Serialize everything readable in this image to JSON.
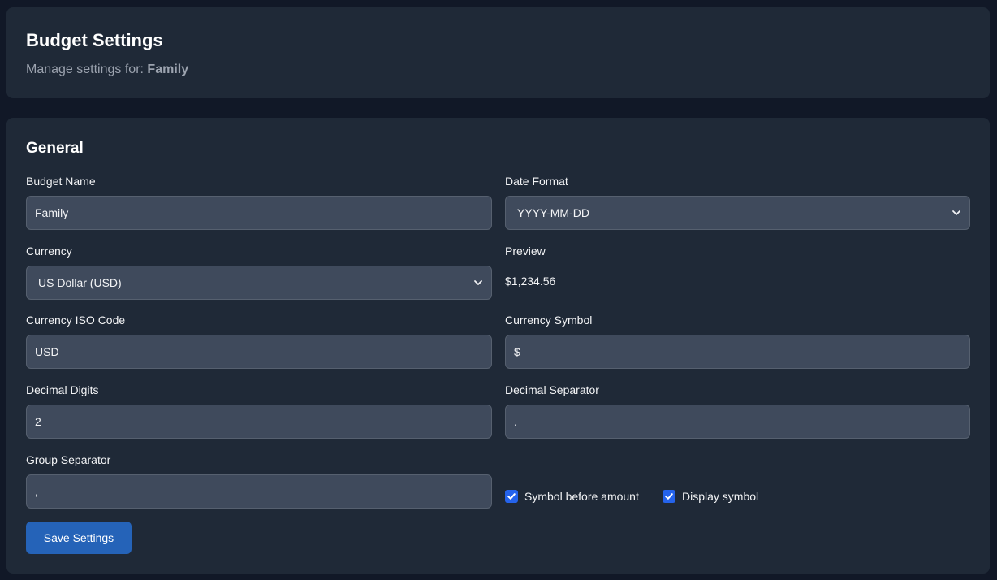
{
  "header": {
    "title": "Budget Settings",
    "subtitle_prefix": "Manage settings for:",
    "budget_name": "Family"
  },
  "general": {
    "section_title": "General",
    "budget_name": {
      "label": "Budget Name",
      "value": "Family"
    },
    "date_format": {
      "label": "Date Format",
      "value": "YYYY-MM-DD"
    },
    "currency": {
      "label": "Currency",
      "value": "US Dollar (USD)"
    },
    "preview": {
      "label": "Preview",
      "value": "$1,234.56"
    },
    "currency_iso": {
      "label": "Currency ISO Code",
      "value": "USD"
    },
    "currency_symbol": {
      "label": "Currency Symbol",
      "value": "$"
    },
    "decimal_digits": {
      "label": "Decimal Digits",
      "value": "2"
    },
    "decimal_separator": {
      "label": "Decimal Separator",
      "value": "."
    },
    "group_separator": {
      "label": "Group Separator",
      "value": ","
    },
    "symbol_before_amount": {
      "label": "Symbol before amount",
      "checked": true
    },
    "display_symbol": {
      "label": "Display symbol",
      "checked": true
    },
    "save_label": "Save Settings"
  },
  "colors": {
    "background": "#111827",
    "card": "#1f2937",
    "input": "#3f4a5c",
    "accent": "#2563eb",
    "button": "#2563b8"
  }
}
